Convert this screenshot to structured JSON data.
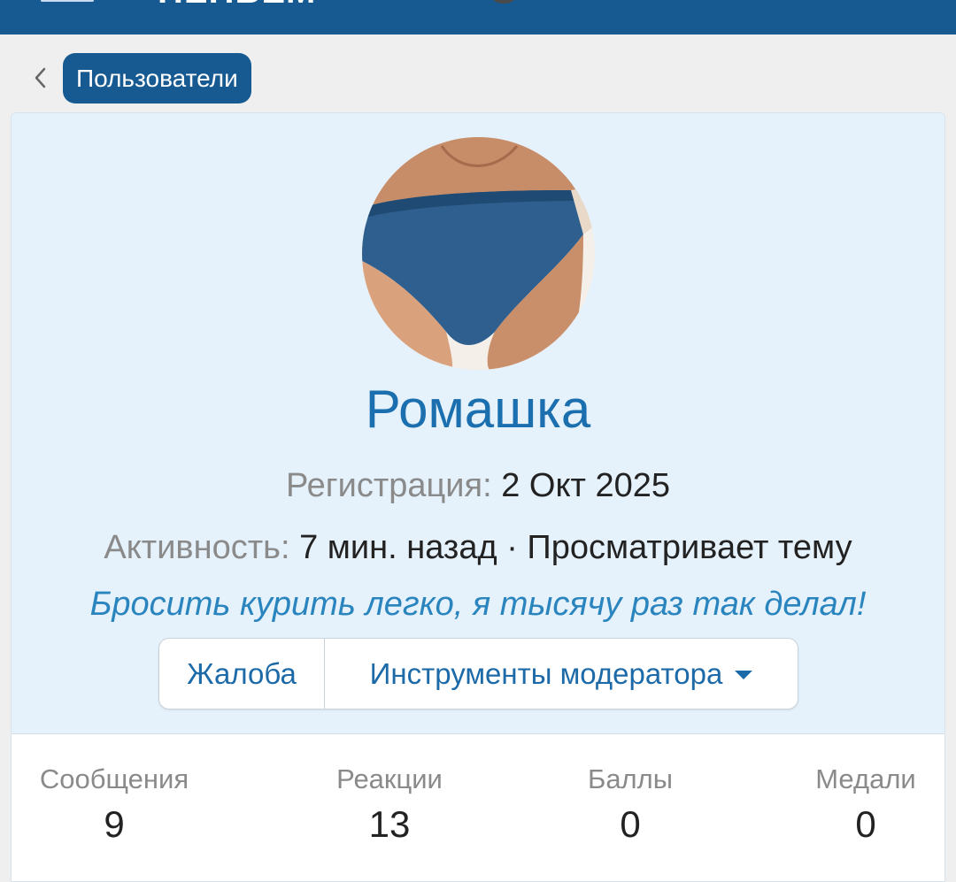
{
  "header": {
    "logo_text": "HEHBEM"
  },
  "breadcrumb": {
    "label": "Пользователи"
  },
  "profile": {
    "username": "Ромашка",
    "registration_label": "Регистрация:",
    "registration_value": "2 Окт 2025",
    "activity_label": "Активность:",
    "activity_value": "7 мин. назад · Просматривает тему",
    "status_text": "Бросить курить легко, я тысячу раз так делал!"
  },
  "actions": {
    "report_label": "Жалоба",
    "moderator_tools_label": "Инструменты модератора"
  },
  "stats": [
    {
      "label": "Сообщения",
      "value": "9"
    },
    {
      "label": "Реакции",
      "value": "13"
    },
    {
      "label": "Баллы",
      "value": "0"
    },
    {
      "label": "Медали",
      "value": "0"
    }
  ],
  "colors": {
    "brand": "#175a92",
    "link": "#1b6fae",
    "header_bg": "#e5f1fb"
  }
}
